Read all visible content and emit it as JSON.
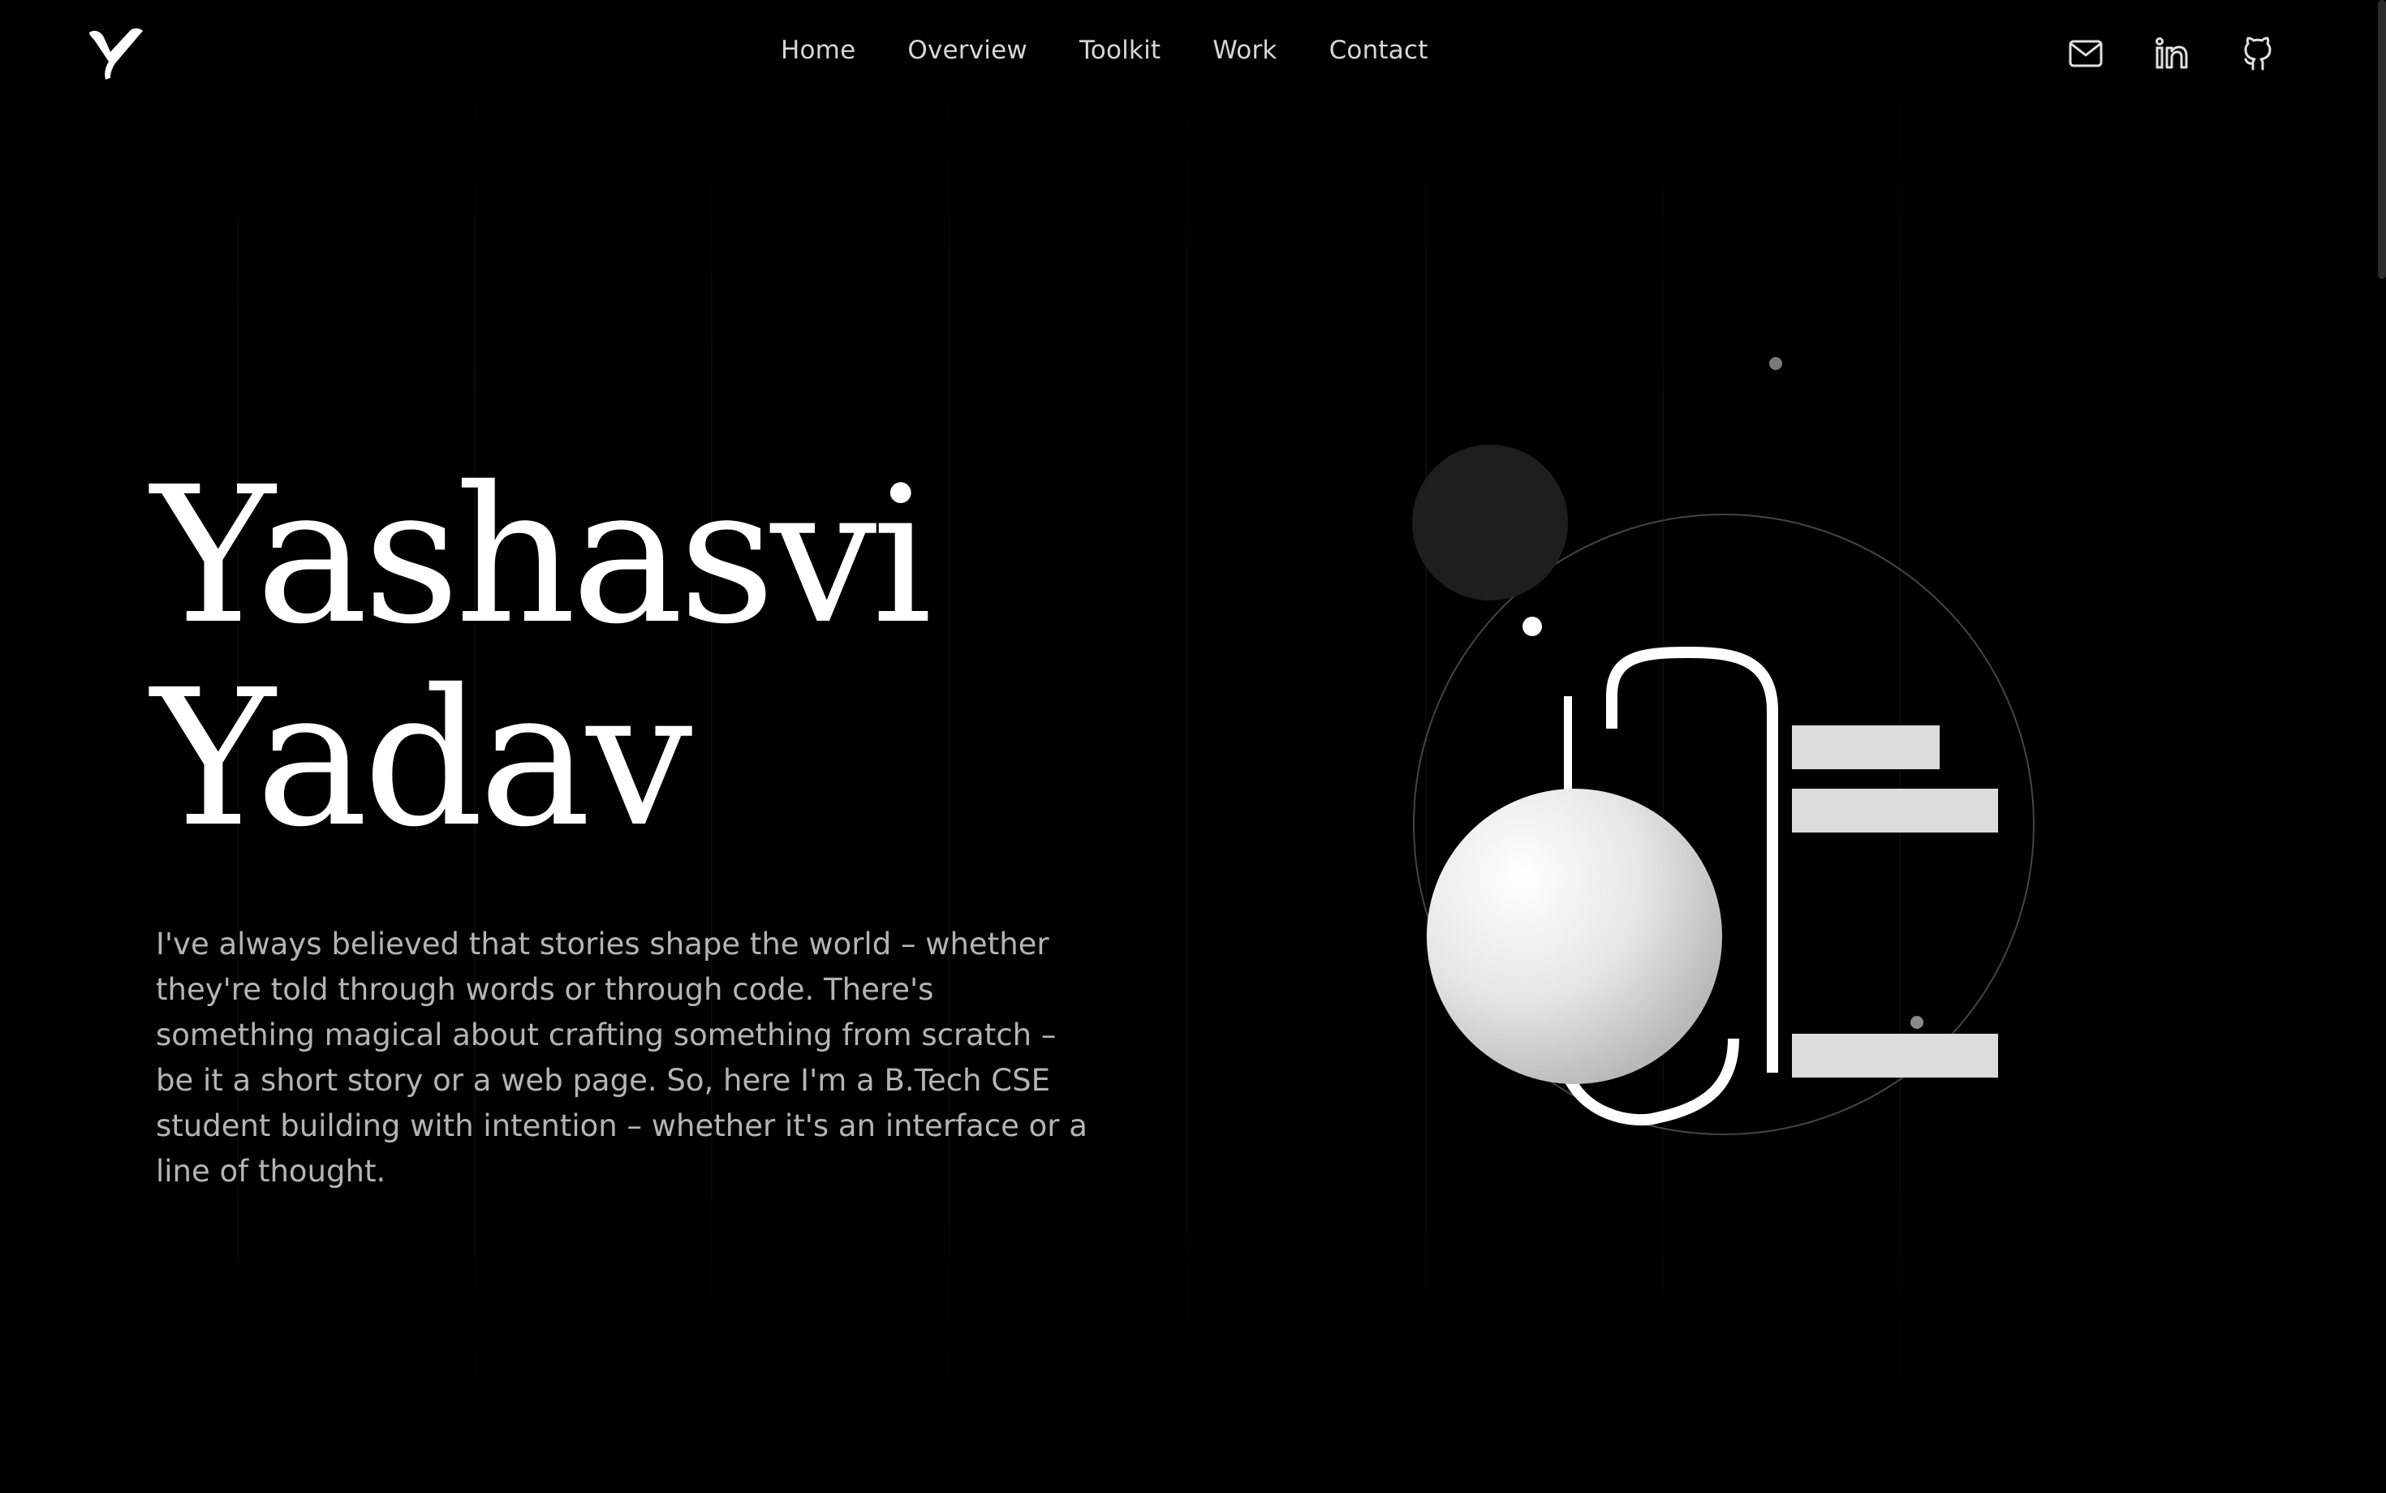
{
  "logo": {
    "icon": "y-monogram-icon"
  },
  "nav": {
    "items": [
      {
        "label": "Home"
      },
      {
        "label": "Overview"
      },
      {
        "label": "Toolkit"
      },
      {
        "label": "Work"
      },
      {
        "label": "Contact"
      }
    ]
  },
  "social": {
    "icons": [
      "mail-icon",
      "linkedin-icon",
      "github-icon"
    ]
  },
  "hero": {
    "name_line1": "Yashasvi",
    "name_line2": "Yadav",
    "description": "I've always believed that stories shape the world – whether they're told through words or through code. There's something magical about crafting something from scratch – be it a short story or a web page. So, here I'm a B.Tech CSE student building with intention – whether it's an interface or a line of thought."
  },
  "colors": {
    "background": "#000000",
    "text": "#ffffff",
    "nav_text": "#d6d6d6",
    "body_text": "#b4b4b4",
    "shape_fill": "#dcdcdc"
  }
}
